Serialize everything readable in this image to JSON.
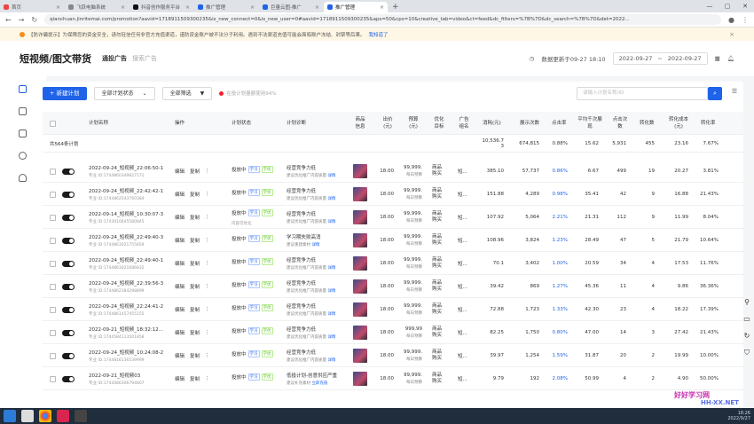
{
  "browser": {
    "tabs": [
      "首页",
      "飞跃电脑系统",
      "抖音创作服务平台",
      "推广管理",
      "巨量云图-推广",
      "推广管理"
    ],
    "active_tab": 5,
    "url": "qianchuan.jinritemai.com/promotion?aavid=1718911509300235&is_new_connect=0&is_new_user=0#aavid=1718911509300235&aps=50&cps=10&creative_tab=video&ct=feed&dc_filters=%7B%7D&dc_search=%7B%7D&det=2022..."
  },
  "notice": {
    "text": "【防诈骗提示】为保障您的资金安全，请勿轻信任何非官方充值渠道，谨防资金账户被不法分子利用。遇到不法渠道充值可能会面临账户冻结、封禁等后果。",
    "link": "我知道了"
  },
  "header": {
    "title": "短视频/图文带货",
    "sub": "通投广告",
    "sub2": "搜索广告",
    "update": "数据更新于09-27 18:10",
    "date_start": "2022-09-27",
    "date_sep": "~",
    "date_end": "2022-09-27"
  },
  "toolbar": {
    "new_btn": "+ 新建计划",
    "status_sel": "全部计划状态",
    "filter_btn": "全部筛选",
    "hint": "在投计划量额使用94%",
    "search_placeholder": "请输入计划名称/ID"
  },
  "columns": [
    "计划名称",
    "操作",
    "计划状态",
    "计划诊断",
    "商品信息",
    "出价(元)",
    "预算(元)",
    "优化目标",
    "广告组名",
    "消耗(元)",
    "展示次数",
    "点击率",
    "平均千次展现",
    "点击次数",
    "转化数",
    "转化成本(元)",
    "转化率"
  ],
  "summary": {
    "label": "共564条计划",
    "cost": "10,536.7",
    "cost2": "3",
    "impressions": "674,815",
    "ctr": "0.88%",
    "cpm": "15.62",
    "clicks": "5,931",
    "conv": "455",
    "conv_cost": "23.16",
    "conv_rate": "7.67%"
  },
  "rows": [
    {
      "name": "2022-09-24_短视频_22:06:50-1",
      "id": "专业 ID:1744860349827171",
      "status": "投放中",
      "diag": "经营竞争力低",
      "diag2": "建议优化推广内容质量",
      "diag_link": "详情",
      "bid": "18.00",
      "budget": "99,999.",
      "budget2": "每日预算",
      "opt": "商品购买",
      "group": "短...",
      "cost": "385.10",
      "imp": "57,737",
      "ctr": "0.86%",
      "cpm": "6.67",
      "clicks": "499",
      "conv": "19",
      "conv_cost": "20.27",
      "conv_rate": "3.81%"
    },
    {
      "name": "2022-09-24_短视频_22:42:42-1",
      "id": "专业 ID:1744862543760384",
      "status": "投放中",
      "diag": "经营竞争力低",
      "diag2": "建议优化推广内容质量",
      "diag_link": "详情",
      "bid": "18.00",
      "budget": "99,999.",
      "budget2": "每日预算",
      "opt": "商品购买",
      "group": "短...",
      "cost": "151.88",
      "imp": "4,289",
      "ctr": "0.98%",
      "cpm": "35.41",
      "clicks": "42",
      "conv": "9",
      "conv_cost": "16.88",
      "conv_rate": "21.43%"
    },
    {
      "name": "2022-09-14_短视频_10:30:07-3",
      "id": "专业 ID:1743910645580845",
      "status": "投放中",
      "diag": "经营竞争力低",
      "diag2": "建议优化推广内容质量",
      "diag_link": "详情",
      "extra": "内容可优化",
      "bid": "18.00",
      "budget": "99,999.",
      "budget2": "每日预算",
      "opt": "商品购买",
      "group": "短...",
      "cost": "107.92",
      "imp": "5,064",
      "ctr": "2.21%",
      "cpm": "21.31",
      "clicks": "112",
      "conv": "9",
      "conv_cost": "11.99",
      "conv_rate": "8.04%"
    },
    {
      "name": "2022-09-24_短视频_22:49:40-3",
      "id": "专业 ID:1744863021755659",
      "status": "投放中",
      "diag": "学习期失败高消",
      "diag2": "建议重建素材",
      "diag_link": "详情",
      "bid": "18.00",
      "budget": "99,999.",
      "budget2": "每日预算",
      "opt": "商品购买",
      "group": "短...",
      "cost": "108.96",
      "imp": "3,824",
      "ctr": "1.23%",
      "cpm": "28.49",
      "clicks": "47",
      "conv": "5",
      "conv_cost": "21.79",
      "conv_rate": "10.64%"
    },
    {
      "name": "2022-09-24_短视频_22:49:40-1",
      "id": "专业 ID:1744863021686832",
      "status": "投放中",
      "diag": "经营竞争力低",
      "diag2": "建议优化推广内容质量",
      "diag_link": "详情",
      "bid": "18.00",
      "budget": "99,999.",
      "budget2": "每日预算",
      "opt": "商品购买",
      "group": "短...",
      "cost": "70.1",
      "imp": "3,402",
      "ctr": "1.00%",
      "cpm": "20.59",
      "clicks": "34",
      "conv": "4",
      "conv_cost": "17.53",
      "conv_rate": "11.76%"
    },
    {
      "name": "2022-09-24_短视频_22:39:56-3",
      "id": "专业 ID:1744862384298899",
      "status": "投放中",
      "diag": "经营竞争力低",
      "diag2": "建议优化推广内容质量",
      "diag_link": "详情",
      "bid": "18.00",
      "budget": "99,999.",
      "budget2": "每日预算",
      "opt": "商品购买",
      "group": "短...",
      "cost": "39.42",
      "imp": "869",
      "ctr": "1.27%",
      "cpm": "45.36",
      "clicks": "11",
      "conv": "4",
      "conv_cost": "9.86",
      "conv_rate": "36.36%"
    },
    {
      "name": "2022-09-24_短视频_22:24:41-2",
      "id": "专业 ID:1744861457455155",
      "status": "投放中",
      "diag": "经营竞争力低",
      "diag2": "建议优化推广内容质量",
      "diag_link": "详情",
      "bid": "18.00",
      "budget": "99,999.",
      "budget2": "每日预算",
      "opt": "商品购买",
      "group": "短...",
      "cost": "72.88",
      "imp": "1,723",
      "ctr": "1.33%",
      "cpm": "42.30",
      "clicks": "23",
      "conv": "4",
      "conv_cost": "18.22",
      "conv_rate": "17.39%"
    },
    {
      "name": "2022-09-21_短视频_18:32:12...",
      "id": "专业 ID:1744584113501858",
      "status": "投放中",
      "diag": "经营竞争力低",
      "diag2": "建议优化推广内容质量",
      "diag_link": "详情",
      "bid": "18.00",
      "budget": "999,99",
      "budget2": "每日预算",
      "opt": "商品购买",
      "group": "短...",
      "cost": "82.25",
      "imp": "1,750",
      "ctr": "0.80%",
      "cpm": "47.00",
      "clicks": "14",
      "conv": "3",
      "conv_cost": "27.42",
      "conv_rate": "21.43%"
    },
    {
      "name": "2022-09-24_短视频_10:24:08-2",
      "id": "专业 ID:1744816136539999",
      "status": "投放中",
      "diag": "经营竞争力低",
      "diag2": "建议优化推广内容质量",
      "diag_link": "详情",
      "bid": "18.00",
      "budget": "99,999.",
      "budget2": "每日预算",
      "opt": "商品购买",
      "group": "短...",
      "cost": "39.97",
      "imp": "1,254",
      "ctr": "1.59%",
      "cpm": "31.87",
      "clicks": "20",
      "conv": "2",
      "conv_cost": "19.99",
      "conv_rate": "10.00%"
    },
    {
      "name": "2022-09-21_短视频03",
      "id": "专业 ID:1743086306794807",
      "status": "投放中",
      "diag": "低投计划-创意供应严重",
      "diag2": "建议补充素材",
      "diag_link": "立即充值",
      "bid": "18.00",
      "budget": "99,999.",
      "budget2": "每日预算",
      "opt": "商品购买",
      "group": "短...",
      "cost": "9.79",
      "imp": "192",
      "ctr": "2.08%",
      "cpm": "50.99",
      "clicks": "4",
      "conv": "2",
      "conv_cost": "4.90",
      "conv_rate": "50.00%"
    }
  ],
  "row_labels": {
    "edit": "编辑",
    "copy": "复制",
    "more": "⋮",
    "tag1": "学习",
    "tag2": "学优"
  },
  "taskbar": {
    "time": "18:26",
    "date": "2022/9/27"
  },
  "watermark": {
    "line1": "好好学习网",
    "line2": "HH-XX.NET"
  }
}
